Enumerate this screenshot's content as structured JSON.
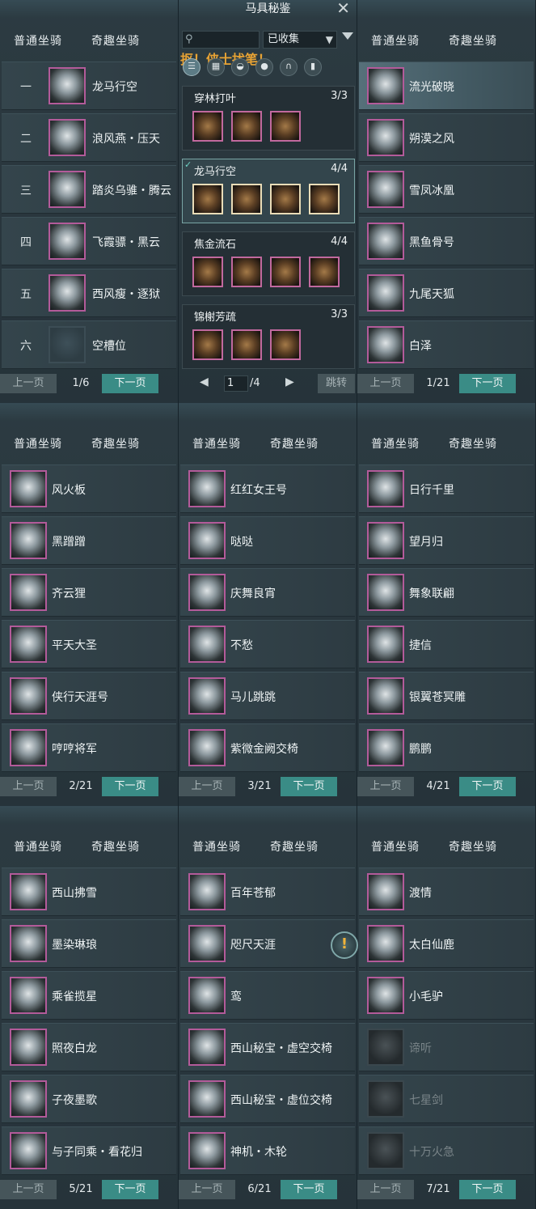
{
  "center": {
    "title": "马具秘鉴",
    "filter": "已收集",
    "watermark": "抠！侠士扰笔！",
    "sets": [
      {
        "name": "穿林打叶",
        "count": "3/3",
        "pieces": 3,
        "selected": false
      },
      {
        "name": "龙马行空",
        "count": "4/4",
        "pieces": 4,
        "selected": true
      },
      {
        "name": "焦金流石",
        "count": "4/4",
        "pieces": 4,
        "selected": false
      },
      {
        "name": "锦榭芳疏",
        "count": "3/3",
        "pieces": 3,
        "selected": false
      }
    ],
    "page_current": "1",
    "page_total": "/4",
    "jump_label": "跳转"
  },
  "tabs": {
    "normal": "普通坐骑",
    "fun": "奇趣坐骑"
  },
  "pager": {
    "prev": "上一页",
    "next": "下一页"
  },
  "panels": [
    {
      "id": "p-slots",
      "page": "1/6",
      "numbered": true,
      "items": [
        {
          "num": "一",
          "name": "龙马行空",
          "selected": false
        },
        {
          "num": "二",
          "name": "浪风燕・压天"
        },
        {
          "num": "三",
          "name": "踏炎乌骓・腾云"
        },
        {
          "num": "四",
          "name": "飞霞骠・黑云"
        },
        {
          "num": "五",
          "name": "西风瘦・逐狱"
        },
        {
          "num": "六",
          "name": "空槽位",
          "empty": true
        }
      ]
    },
    {
      "id": "p1",
      "page": "1/21",
      "items": [
        {
          "name": "流光破晓",
          "selected": true
        },
        {
          "name": "朔漠之风"
        },
        {
          "name": "雪凤冰凰"
        },
        {
          "name": "黑鱼骨号"
        },
        {
          "name": "九尾天狐"
        },
        {
          "name": "白泽"
        }
      ]
    },
    {
      "id": "p2",
      "page": "2/21",
      "items": [
        {
          "name": "风火板"
        },
        {
          "name": "黑蹭蹭"
        },
        {
          "name": "齐云狸"
        },
        {
          "name": "平天大圣"
        },
        {
          "name": "侠行天涯号"
        },
        {
          "name": "哼哼将军"
        }
      ]
    },
    {
      "id": "p3",
      "page": "3/21",
      "items": [
        {
          "name": "红红女王号"
        },
        {
          "name": "哒哒"
        },
        {
          "name": "庆舞良宵"
        },
        {
          "name": "不愁"
        },
        {
          "name": "马儿跳跳"
        },
        {
          "name": "紫微金阙交椅"
        }
      ]
    },
    {
      "id": "p4",
      "page": "4/21",
      "items": [
        {
          "name": "日行千里"
        },
        {
          "name": "望月归"
        },
        {
          "name": "舞象联翩"
        },
        {
          "name": "捷信"
        },
        {
          "name": "银翼苍冥雕"
        },
        {
          "name": "鹏鹏"
        }
      ]
    },
    {
      "id": "p5",
      "page": "5/21",
      "items": [
        {
          "name": "西山拂雪"
        },
        {
          "name": "墨染琳琅"
        },
        {
          "name": "乘雀揽星"
        },
        {
          "name": "照夜白龙"
        },
        {
          "name": "子夜墨歌"
        },
        {
          "name": "与子同乘・看花归"
        }
      ]
    },
    {
      "id": "p6",
      "page": "6/21",
      "items": [
        {
          "name": "百年苍郁"
        },
        {
          "name": "咫尺天涯"
        },
        {
          "name": "鸾"
        },
        {
          "name": "西山秘宝・虚空交椅"
        },
        {
          "name": "西山秘宝・虚位交椅"
        },
        {
          "name": "神机・木轮"
        }
      ]
    },
    {
      "id": "p7",
      "page": "7/21",
      "items": [
        {
          "name": "渡情"
        },
        {
          "name": "太白仙鹿"
        },
        {
          "name": "小毛驴"
        },
        {
          "name": "谛听",
          "dim": true
        },
        {
          "name": "七星剑",
          "dim": true
        },
        {
          "name": "十万火急",
          "dim": true
        }
      ]
    }
  ]
}
